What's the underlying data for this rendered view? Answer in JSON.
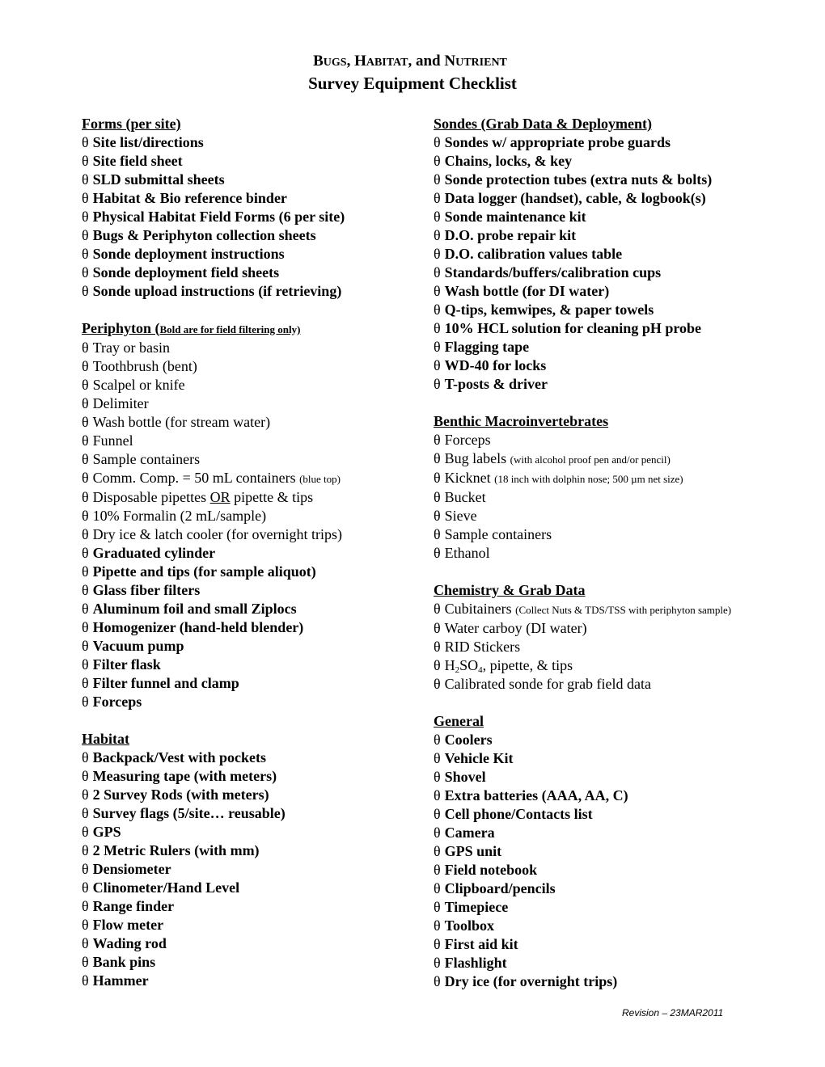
{
  "title": {
    "line1_parts": [
      {
        "cap": "B",
        "rest": "ugs"
      },
      {
        "text": ", "
      },
      {
        "cap": "H",
        "rest": "abitat"
      },
      {
        "text": ", and "
      },
      {
        "cap": "N",
        "rest": "utrient"
      }
    ],
    "line1": "Bugs, Habitat, and Nutrient",
    "line2": "Survey Equipment Checklist"
  },
  "checkbox_glyph": "θ",
  "left_column": {
    "forms": {
      "heading": "Forms (per site)",
      "items": [
        "Site list/directions",
        "Site field sheet",
        "SLD submittal sheets",
        "Habitat & Bio reference binder",
        "Physical Habitat Field Forms (6 per site)",
        "Bugs & Periphyton collection sheets",
        "Sonde deployment instructions",
        "Sonde deployment field sheets",
        "Sonde upload instructions (if retrieving)"
      ]
    },
    "periphyton": {
      "heading": "Periphyton (",
      "heading_note": "Bold are for field filtering only)",
      "items": [
        {
          "text": "Tray or basin"
        },
        {
          "text": "Toothbrush (bent)"
        },
        {
          "text": "Scalpel or knife"
        },
        {
          "text": "Delimiter"
        },
        {
          "text": "Wash bottle (for stream water)"
        },
        {
          "text": "Funnel"
        },
        {
          "text": "Sample containers"
        },
        {
          "text": "Comm. Comp. = 50 mL containers",
          "note": "(blue top)"
        },
        {
          "pre": "Disposable pipettes ",
          "underlined": "OR",
          "post": " pipette & tips"
        },
        {
          "text": "10% Formalin (2 mL/sample)"
        },
        {
          "text": "Dry ice & latch cooler (for overnight trips)"
        },
        {
          "text": "Graduated cylinder",
          "bold": true
        },
        {
          "text": "Pipette and tips (for sample aliquot)",
          "bold": true
        },
        {
          "text": "Glass fiber filters",
          "bold": true
        },
        {
          "text": "Aluminum foil and small Ziplocs",
          "bold": true
        },
        {
          "text": "Homogenizer (hand-held blender)",
          "bold": true
        },
        {
          "text": "Vacuum pump",
          "bold": true
        },
        {
          "text": "Filter flask",
          "bold": true
        },
        {
          "text": "Filter funnel and clamp",
          "bold": true
        },
        {
          "text": "Forceps",
          "bold": true
        }
      ]
    },
    "habitat": {
      "heading": "Habitat ",
      "items": [
        "Backpack/Vest with pockets",
        "Measuring tape (with meters)",
        "2 Survey Rods (with meters)",
        "Survey flags (5/site… reusable)",
        "GPS",
        "2 Metric Rulers (with mm)",
        "Densiometer",
        "Clinometer/Hand Level",
        "Range finder",
        "Flow meter",
        "Wading rod",
        "Bank pins",
        "Hammer"
      ]
    }
  },
  "right_column": {
    "sondes": {
      "heading": "Sondes (Grab Data & Deployment)",
      "items": [
        "Sondes w/ appropriate probe guards",
        "Chains, locks, & key",
        "Sonde protection tubes (extra nuts & bolts)",
        "Data logger (handset), cable, & logbook(s)",
        "Sonde maintenance kit",
        "D.O. probe repair kit",
        "D.O. calibration values table",
        "Standards/buffers/calibration cups",
        "Wash bottle (for DI water)",
        "Q-tips, kemwipes, & paper towels",
        "10% HCL solution for cleaning pH probe",
        "Flagging tape",
        "WD-40 for locks",
        "T-posts & driver"
      ]
    },
    "benthic": {
      "heading": "Benthic Macroinvertebrates",
      "items": [
        {
          "text": "Forceps"
        },
        {
          "text": "Bug labels",
          "note": "(with alcohol proof pen and/or pencil)"
        },
        {
          "text": "Kicknet",
          "note": "(18 inch with dolphin nose; 500 µm net size)"
        },
        {
          "text": "Bucket"
        },
        {
          "text": "Sieve"
        },
        {
          "text": "Sample containers"
        },
        {
          "text": "Ethanol"
        }
      ]
    },
    "chemistry": {
      "heading": "Chemistry & Grab Data",
      "items": [
        {
          "text": "Cubitainers",
          "note": "(Collect Nuts & TDS/TSS with periphyton sample)"
        },
        {
          "text": "Water carboy (DI water)"
        },
        {
          "text": "RID Stickers"
        },
        {
          "formula": {
            "h": "H",
            "h_sub": "2",
            "so": "SO",
            "o_sub": "4"
          },
          "post": ", pipette, & tips"
        },
        {
          "text": "Calibrated sonde for grab field data"
        }
      ]
    },
    "general": {
      "heading": "General",
      "items": [
        "Coolers",
        "Vehicle Kit",
        "Shovel",
        "Extra batteries (AAA, AA, C)",
        "Cell phone/Contacts list",
        "Camera",
        "GPS unit",
        "Field notebook",
        "Clipboard/pencils",
        "Timepiece",
        "Toolbox",
        "First aid kit",
        "Flashlight",
        "Dry ice (for overnight trips)"
      ]
    }
  },
  "footer": {
    "revision": "Revision – 23MAR2011"
  }
}
